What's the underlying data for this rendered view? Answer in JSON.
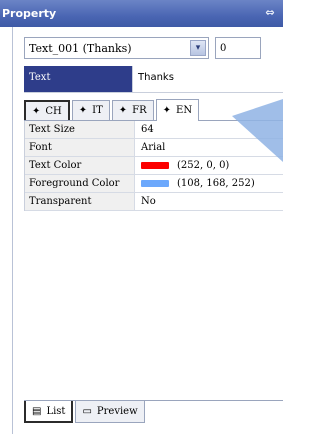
{
  "window": {
    "title": "Property",
    "pin_glyph": "⇔"
  },
  "selector": {
    "object_value": "Text_001 (Thanks)",
    "dropdown_glyph": "▾",
    "number_value": "0"
  },
  "text_row": {
    "label": "Text",
    "value": "Thanks"
  },
  "lang_tabs": [
    {
      "label": "CH",
      "icon": "✦"
    },
    {
      "label": "IT",
      "icon": "✦"
    },
    {
      "label": "FR",
      "icon": "✦"
    },
    {
      "label": "EN",
      "icon": "✦"
    }
  ],
  "properties": [
    {
      "label": "Text Size",
      "value": "64"
    },
    {
      "label": "Font",
      "value": "Arial"
    },
    {
      "label": "Text Color",
      "value": "(252, 0, 0)",
      "swatch": "#fc0000"
    },
    {
      "label": "Foreground Color",
      "value": "(108, 168, 252)",
      "swatch": "#6ca8fc"
    },
    {
      "label": "Transparent",
      "value": "No"
    }
  ],
  "bottom_tabs": [
    {
      "label": "List",
      "icon": "▤"
    },
    {
      "label": "Preview",
      "icon": "▭"
    }
  ],
  "colors": {
    "title_bar": "#4a66b3",
    "selected_key": "#2e3d8a",
    "callout": "#8fb3e4"
  }
}
